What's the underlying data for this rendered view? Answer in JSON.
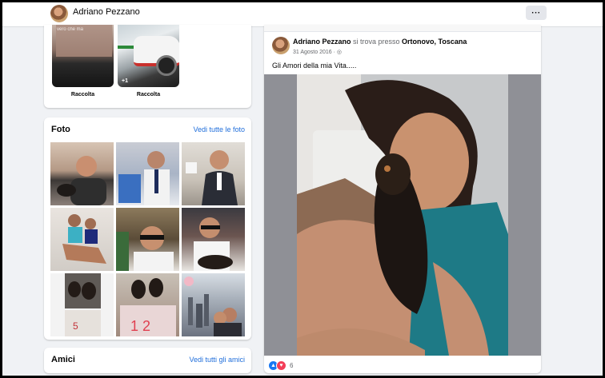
{
  "profile": {
    "name": "Adriano Pezzano"
  },
  "header": {
    "more_label": "···"
  },
  "stories": {
    "items": [
      {
        "label": "Raccolta",
        "overlay_text": "",
        "caption": "vero che ma"
      },
      {
        "label": "Raccolta",
        "overlay_text": "+1"
      }
    ]
  },
  "photos": {
    "title": "Foto",
    "see_all": "Vedi tutte le foto",
    "count": 9
  },
  "friends": {
    "title": "Amici",
    "see_all": "Vedi tutti gli amici"
  },
  "post": {
    "author": "Adriano Pezzano",
    "location_prefix": " si trova presso ",
    "location": "Ortonovo, Toscana",
    "date": "31 Agosto 2016",
    "privacy_icon": "globe-icon",
    "text": "Gli Amori della mia Vita.....",
    "reaction_count": "6",
    "reaction_icons": [
      "like-icon",
      "love-icon"
    ]
  },
  "colors": {
    "link": "#216fdb",
    "background": "#f0f2f5",
    "like": "#1877f2",
    "love": "#f33e58"
  }
}
